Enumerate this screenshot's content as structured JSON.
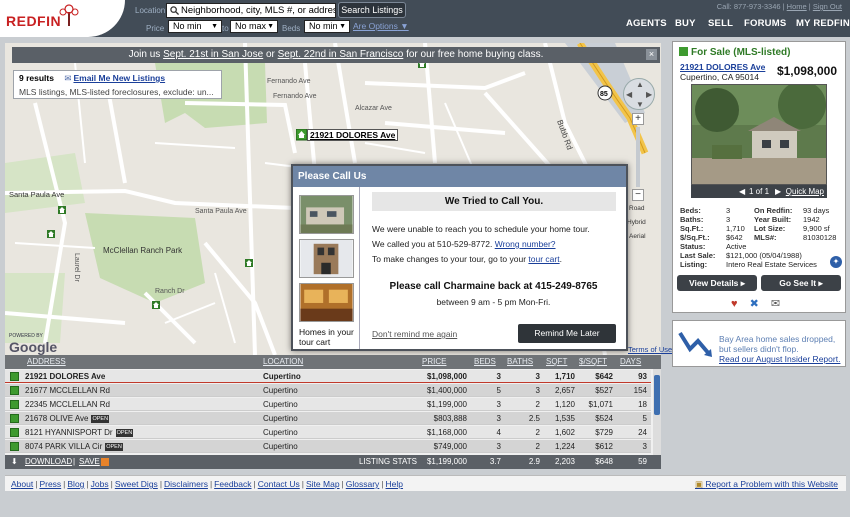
{
  "brand": {
    "name": "REDFIN"
  },
  "search": {
    "location_label": "Location",
    "location_value": "Neighborhood, city, MLS #, or address",
    "button_label": "Search Listings",
    "price_label": "Price",
    "price_min": "No min",
    "to_label": "to",
    "price_max": "No max",
    "beds_label": "Beds",
    "beds_min": "No min",
    "more_options": "Are Options"
  },
  "utility": {
    "call": "Call: 877-973-3346",
    "home": "Home",
    "signout": "Sign Out"
  },
  "nav": [
    "AGENTS",
    "BUY",
    "SELL",
    "FORUMS",
    "MY REDFIN"
  ],
  "announcement": {
    "pre": "Join us",
    "link1": "Sept. 21st in San Jose",
    "mid": "or",
    "link2": "Sept. 22nd in San Francisco",
    "post": "for our free home buying class."
  },
  "results": {
    "count": "9 results",
    "email_link": "Email Me New Listings",
    "description": "MLS listings, MLS-listed foreclosures, exclude: un..."
  },
  "map": {
    "labels": [
      "21921 DOLORES Ave",
      "Santa Paula Ave",
      "McClellan Ranch Park",
      "Bubb Rd",
      "Terms of Use",
      "POWERED BY",
      "Google"
    ],
    "hwy": "85",
    "map_types": [
      "Road",
      "Hybrid",
      "Aerial"
    ]
  },
  "dialog": {
    "title": "Please Call Us",
    "heading": "We Tried to Call You.",
    "line1": "We were unable to reach you to schedule your home tour.",
    "line2_pre": "We called you at 510-529-8772.",
    "line2_link": "Wrong number?",
    "line3_pre": "To make changes to your tour, go to your",
    "line3_link": "tour cart",
    "callback": "Please call Charmaine back at 415-249-8765",
    "hours": "between 9 am - 5 pm Mon-Fri.",
    "dont_remind": "Don't remind me again",
    "remind_later": "Remind Me Later",
    "homes_caption": "Homes in your tour cart"
  },
  "table": {
    "columns": [
      "ADDRESS",
      "LOCATION",
      "PRICE",
      "BEDS",
      "BATHS",
      "SQFT",
      "$/SQFT",
      "DAYS"
    ],
    "rows": [
      {
        "address": "21921 DOLORES Ave",
        "tag": "",
        "location": "Cupertino",
        "price": "$1,098,000",
        "beds": "3",
        "baths": "3",
        "sqft": "1,710",
        "psf": "$642",
        "days": "93"
      },
      {
        "address": "21677 MCCLELLAN Rd",
        "tag": "",
        "location": "Cupertino",
        "price": "$1,400,000",
        "beds": "5",
        "baths": "3",
        "sqft": "2,657",
        "psf": "$527",
        "days": "154"
      },
      {
        "address": "22345 MCCLELLAN Rd",
        "tag": "",
        "location": "Cupertino",
        "price": "$1,199,000",
        "beds": "3",
        "baths": "2",
        "sqft": "1,120",
        "psf": "$1,071",
        "days": "18"
      },
      {
        "address": "21678 OLIVE Ave",
        "tag": "OPEN",
        "location": "Cupertino",
        "price": "$803,888",
        "beds": "3",
        "baths": "2.5",
        "sqft": "1,535",
        "psf": "$524",
        "days": "5"
      },
      {
        "address": "8121 HYANNISPORT Dr",
        "tag": "OPEN",
        "location": "Cupertino",
        "price": "$1,168,000",
        "beds": "4",
        "baths": "2",
        "sqft": "1,602",
        "psf": "$729",
        "days": "24"
      },
      {
        "address": "8074 PARK VILLA Cir",
        "tag": "OPEN",
        "location": "Cupertino",
        "price": "$749,000",
        "beds": "3",
        "baths": "2",
        "sqft": "1,224",
        "psf": "$612",
        "days": "3"
      }
    ],
    "footer": {
      "download": "DOWNLOAD",
      "save": "SAVE",
      "stats_label": "LISTING STATS",
      "price": "$1,199,000",
      "beds": "3.7",
      "baths": "2.9",
      "sqft": "2,203",
      "psf": "$648",
      "days": "59"
    }
  },
  "listing": {
    "status": "For Sale (MLS-listed)",
    "address": "21921 DOLORES Ave",
    "city": "Cupertino, CA 95014",
    "price": "$1,098,000",
    "photo_counter": "1 of 1",
    "quick_map": "Quick Map",
    "facts_left": [
      {
        "k": "Beds:",
        "v": "3"
      },
      {
        "k": "Baths:",
        "v": "3"
      },
      {
        "k": "Sq.Ft.:",
        "v": "1,710"
      },
      {
        "k": "$/Sq.Ft.:",
        "v": "$642"
      },
      {
        "k": "Status:",
        "v": "Active"
      },
      {
        "k": "Last Sale:",
        "v": "$121,000 (05/04/1988)"
      },
      {
        "k": "Listing:",
        "v": "Intero Real Estate Services"
      }
    ],
    "facts_right": [
      {
        "k": "On Redfin:",
        "v": "93 days"
      },
      {
        "k": "Year Built:",
        "v": "1942"
      },
      {
        "k": "Lot Size:",
        "v": "9,900 sf"
      },
      {
        "k": "MLS#:",
        "v": "81030128"
      }
    ],
    "view_details": "View Details",
    "go_see_it": "Go See It"
  },
  "insider": {
    "line1": "Bay Area home sales dropped,",
    "line2": "but sellers didn't flop.",
    "link": "Read our August Insider Report."
  },
  "footer": {
    "links": [
      "About",
      "Press",
      "Blog",
      "Jobs",
      "Sweet Digs",
      "Disclaimers",
      "Feedback",
      "Contact Us",
      "Site Map",
      "Glossary",
      "Help"
    ],
    "report": "Report a Problem with this Website"
  },
  "colors": {
    "brand_red": "#c82021",
    "listing_green": "#3e9a2f",
    "dialog_header": "#6f86a6",
    "topbar": "#424c57"
  }
}
